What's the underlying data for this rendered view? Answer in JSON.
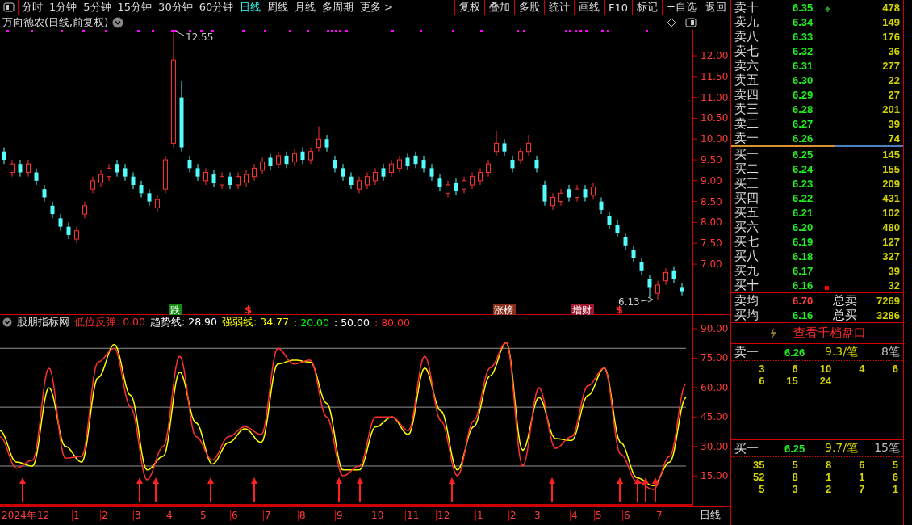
{
  "toolbar": {
    "periods": [
      {
        "label": "分时",
        "selected": false
      },
      {
        "label": "1分钟",
        "selected": false
      },
      {
        "label": "5分钟",
        "selected": false
      },
      {
        "label": "15分钟",
        "selected": false
      },
      {
        "label": "30分钟",
        "selected": false
      },
      {
        "label": "60分钟",
        "selected": false
      },
      {
        "label": "日线",
        "selected": true
      },
      {
        "label": "周线",
        "selected": false
      },
      {
        "label": "月线",
        "selected": false
      },
      {
        "label": "多周期",
        "selected": false
      },
      {
        "label": "更多 >",
        "selected": false
      }
    ],
    "buttons": [
      "复权",
      "叠加",
      "多股",
      "统计",
      "画线",
      "F10",
      "标记",
      "+自选",
      "返回"
    ]
  },
  "chart": {
    "title": "万向德农(日线,前复权)",
    "high_label": "12.55",
    "low_label": "6.13",
    "chart_data": {
      "type": "candlestick",
      "ylim": [
        5.8,
        12.62
      ],
      "yticks": [
        {
          "value": 12,
          "label": "12.00"
        },
        {
          "value": 11.5,
          "label": "11.50"
        },
        {
          "value": 11,
          "label": "11.00"
        },
        {
          "value": 10.5,
          "label": "10.50"
        },
        {
          "value": 10,
          "label": "10.00"
        },
        {
          "value": 9.5,
          "label": "9.50"
        },
        {
          "value": 9,
          "label": "9.00"
        },
        {
          "value": 8.5,
          "label": "8.50"
        },
        {
          "value": 8,
          "label": "8.00"
        },
        {
          "value": 7.5,
          "label": "7.50"
        },
        {
          "value": 7,
          "label": "7.00"
        }
      ],
      "ohlc": [
        [
          9.7,
          9.8,
          9.4,
          9.5
        ],
        [
          9.2,
          9.5,
          9.1,
          9.4
        ],
        [
          9.4,
          9.5,
          9.1,
          9.2
        ],
        [
          9.2,
          9.5,
          9.1,
          9.4
        ],
        [
          9.2,
          9.3,
          8.9,
          9.0
        ],
        [
          8.8,
          8.9,
          8.5,
          8.6
        ],
        [
          8.4,
          8.5,
          8.1,
          8.2
        ],
        [
          8.1,
          8.2,
          7.8,
          7.9
        ],
        [
          7.9,
          8.0,
          7.6,
          7.7
        ],
        [
          7.6,
          7.9,
          7.5,
          7.8
        ],
        [
          8.2,
          8.5,
          8.1,
          8.4
        ],
        [
          8.8,
          9.1,
          8.7,
          9.0
        ],
        [
          8.95,
          9.25,
          8.85,
          9.15
        ],
        [
          9.1,
          9.4,
          9.0,
          9.3
        ],
        [
          9.4,
          9.5,
          9.1,
          9.2
        ],
        [
          9.3,
          9.4,
          9.0,
          9.1
        ],
        [
          9.1,
          9.2,
          8.8,
          8.9
        ],
        [
          8.9,
          9.0,
          8.6,
          8.7
        ],
        [
          8.7,
          8.8,
          8.4,
          8.5
        ],
        [
          8.35,
          8.65,
          8.25,
          8.55
        ],
        [
          8.8,
          9.6,
          8.7,
          9.5
        ],
        [
          9.9,
          12.55,
          9.8,
          11.9
        ],
        [
          11.0,
          11.4,
          9.7,
          9.8
        ],
        [
          9.5,
          9.6,
          9.2,
          9.3
        ],
        [
          9.3,
          9.4,
          9.0,
          9.1
        ],
        [
          9.0,
          9.3,
          8.9,
          9.2
        ],
        [
          9.15,
          9.25,
          8.85,
          8.95
        ],
        [
          8.9,
          9.2,
          8.8,
          9.1
        ],
        [
          9.1,
          9.2,
          8.8,
          8.9
        ],
        [
          8.9,
          9.2,
          8.8,
          9.1
        ],
        [
          8.95,
          9.25,
          8.85,
          9.15
        ],
        [
          9.1,
          9.4,
          9.0,
          9.3
        ],
        [
          9.25,
          9.55,
          9.15,
          9.45
        ],
        [
          9.55,
          9.65,
          9.25,
          9.35
        ],
        [
          9.4,
          9.7,
          9.3,
          9.6
        ],
        [
          9.6,
          9.7,
          9.3,
          9.4
        ],
        [
          9.45,
          9.75,
          9.35,
          9.65
        ],
        [
          9.7,
          9.8,
          9.4,
          9.5
        ],
        [
          9.5,
          9.8,
          9.4,
          9.7
        ],
        [
          9.8,
          10.3,
          9.7,
          10.0
        ],
        [
          10.0,
          10.1,
          9.7,
          9.8
        ],
        [
          9.5,
          9.6,
          9.2,
          9.3
        ],
        [
          9.3,
          9.4,
          9.0,
          9.1
        ],
        [
          9.1,
          9.2,
          8.8,
          8.9
        ],
        [
          8.8,
          9.1,
          8.7,
          9.0
        ],
        [
          8.9,
          9.2,
          8.8,
          9.1
        ],
        [
          9.0,
          9.3,
          8.9,
          9.2
        ],
        [
          9.3,
          9.4,
          9.0,
          9.1
        ],
        [
          9.2,
          9.5,
          9.1,
          9.4
        ],
        [
          9.3,
          9.6,
          9.2,
          9.5
        ],
        [
          9.55,
          9.65,
          9.25,
          9.35
        ],
        [
          9.6,
          9.7,
          9.3,
          9.4
        ],
        [
          9.5,
          9.6,
          9.2,
          9.3
        ],
        [
          9.3,
          9.4,
          9.0,
          9.1
        ],
        [
          9.05,
          9.15,
          8.75,
          8.85
        ],
        [
          8.7,
          9.0,
          8.6,
          8.9
        ],
        [
          8.95,
          9.05,
          8.65,
          8.75
        ],
        [
          8.8,
          9.1,
          8.7,
          9.0
        ],
        [
          8.9,
          9.2,
          8.8,
          9.1
        ],
        [
          9.0,
          9.3,
          8.9,
          9.2
        ],
        [
          9.2,
          9.5,
          9.1,
          9.4
        ],
        [
          9.7,
          10.2,
          9.6,
          9.9
        ],
        [
          9.9,
          10.0,
          9.6,
          9.7
        ],
        [
          9.5,
          9.6,
          9.2,
          9.3
        ],
        [
          9.5,
          9.8,
          9.4,
          9.7
        ],
        [
          9.7,
          10.1,
          9.6,
          9.9
        ],
        [
          9.5,
          9.6,
          9.2,
          9.3
        ],
        [
          8.9,
          9.0,
          8.4,
          8.5
        ],
        [
          8.4,
          8.7,
          8.3,
          8.6
        ],
        [
          8.5,
          8.8,
          8.4,
          8.7
        ],
        [
          8.8,
          8.9,
          8.5,
          8.6
        ],
        [
          8.6,
          8.9,
          8.5,
          8.8
        ],
        [
          8.8,
          8.9,
          8.5,
          8.6
        ],
        [
          8.65,
          8.95,
          8.55,
          8.85
        ],
        [
          8.5,
          8.6,
          8.2,
          8.3
        ],
        [
          8.15,
          8.25,
          7.85,
          7.95
        ],
        [
          7.95,
          8.05,
          7.65,
          7.75
        ],
        [
          7.65,
          7.75,
          7.35,
          7.45
        ],
        [
          7.35,
          7.45,
          7.05,
          7.15
        ],
        [
          7.05,
          7.15,
          6.75,
          6.85
        ],
        [
          6.65,
          6.75,
          6.2,
          6.45
        ],
        [
          6.3,
          6.6,
          6.13,
          6.5
        ],
        [
          6.6,
          6.9,
          6.5,
          6.8
        ],
        [
          6.85,
          6.95,
          6.55,
          6.65
        ],
        [
          6.45,
          6.55,
          6.25,
          6.35
        ]
      ]
    },
    "signals": [
      {
        "text": "跌",
        "kind": "tag",
        "color": "#128a12"
      },
      {
        "text": "$",
        "kind": "mark",
        "color": "#ff2a2a"
      },
      {
        "text": "涨榜",
        "kind": "tag",
        "color": "#8a2e1c"
      },
      {
        "text": "增财",
        "kind": "tag",
        "color": "#a01830"
      },
      {
        "text": "$",
        "kind": "mark",
        "color": "#ff2a2a"
      }
    ]
  },
  "indicator": {
    "name": "股朋指标网",
    "legend": [
      {
        "text": "低位反弹: 0.00",
        "color": "#ff2a2a"
      },
      {
        "text": "趋势线: 28.90",
        "color": "#ffffff"
      },
      {
        "text": "强弱线: 34.77",
        "color": "#ffff00"
      },
      {
        "text": ": 20.00",
        "color": "#00ff00"
      },
      {
        "text": ": 50.00",
        "color": "#ffffff"
      },
      {
        "text": ": 80.00",
        "color": "#ff2a2a"
      }
    ],
    "chart_data": {
      "type": "line",
      "ylim": [
        -0.6,
        97
      ],
      "yticks": [
        {
          "value": 90,
          "label": "90.00"
        },
        {
          "value": 75,
          "label": "75.00"
        },
        {
          "value": 60,
          "label": "60.00"
        },
        {
          "value": 45,
          "label": "45.00"
        },
        {
          "value": 30,
          "label": "30.00"
        },
        {
          "value": 15,
          "label": "15.00"
        }
      ],
      "series": [
        {
          "color": "#ffff00",
          "values": [
            38,
            22,
            20,
            60,
            30,
            22,
            65,
            82,
            56,
            18,
            25,
            68,
            42,
            21,
            32,
            39,
            32,
            72,
            74,
            73,
            52,
            18,
            18,
            40,
            45,
            36,
            70,
            48,
            18,
            40,
            66,
            83,
            28,
            55,
            34,
            33,
            56,
            70,
            32,
            14,
            10,
            22,
            55
          ]
        },
        {
          "color": "#ff3030",
          "values": [
            35,
            19,
            23,
            70,
            24,
            25,
            73,
            80,
            50,
            13,
            30,
            76,
            35,
            23,
            35,
            40,
            36,
            80,
            72,
            74,
            45,
            15,
            20,
            45,
            45,
            38,
            76,
            43,
            15,
            43,
            70,
            83,
            20,
            60,
            29,
            35,
            61,
            70,
            26,
            12,
            8,
            25,
            62
          ]
        }
      ]
    }
  },
  "date_axis": {
    "labels": [
      "2024年",
      "12",
      "1",
      "2",
      "3",
      "4",
      "5",
      "6",
      "7",
      "8",
      "9",
      "10",
      "11",
      "12",
      "1",
      "2",
      "3",
      "4",
      "5",
      "6",
      "7"
    ],
    "period": "日线"
  },
  "quote": {
    "asks": [
      {
        "label": "卖十",
        "price": "6.35",
        "volume": "478",
        "marked": true
      },
      {
        "label": "卖九",
        "price": "6.34",
        "volume": "149",
        "marked": false
      },
      {
        "label": "卖八",
        "price": "6.33",
        "volume": "176",
        "marked": false
      },
      {
        "label": "卖七",
        "price": "6.32",
        "volume": "36",
        "marked": false
      },
      {
        "label": "卖六",
        "price": "6.31",
        "volume": "277",
        "marked": false
      },
      {
        "label": "卖五",
        "price": "6.30",
        "volume": "22",
        "marked": false
      },
      {
        "label": "卖四",
        "price": "6.29",
        "volume": "27",
        "marked": false
      },
      {
        "label": "卖三",
        "price": "6.28",
        "volume": "201",
        "marked": false
      },
      {
        "label": "卖二",
        "price": "6.27",
        "volume": "39",
        "marked": false
      },
      {
        "label": "卖一",
        "price": "6.26",
        "volume": "74",
        "marked": false
      }
    ],
    "bids": [
      {
        "label": "买一",
        "price": "6.25",
        "volume": "145",
        "marked": false
      },
      {
        "label": "买二",
        "price": "6.24",
        "volume": "155",
        "marked": false
      },
      {
        "label": "买三",
        "price": "6.23",
        "volume": "209",
        "marked": false
      },
      {
        "label": "买四",
        "price": "6.22",
        "volume": "431",
        "marked": false
      },
      {
        "label": "买五",
        "price": "6.21",
        "volume": "102",
        "marked": false
      },
      {
        "label": "买六",
        "price": "6.20",
        "volume": "480",
        "marked": false
      },
      {
        "label": "买七",
        "price": "6.19",
        "volume": "127",
        "marked": false
      },
      {
        "label": "买八",
        "price": "6.18",
        "volume": "327",
        "marked": false
      },
      {
        "label": "买九",
        "price": "6.17",
        "volume": "39",
        "marked": false
      },
      {
        "label": "买十",
        "price": "6.16",
        "volume": "32",
        "marked": true
      }
    ],
    "summary": [
      {
        "label": "卖均",
        "price": "6.70",
        "rising": true,
        "total_label": "总卖",
        "total": "7269"
      },
      {
        "label": "买均",
        "price": "6.16",
        "rising": false,
        "total_label": "总买",
        "total": "3286"
      }
    ],
    "depth_button": "查看千档盘口",
    "queues": [
      {
        "label": "卖一",
        "price": "6.26",
        "avg": "9.3/笔",
        "count": "8笔",
        "orders": [
          "3",
          "6",
          "10",
          "4",
          "6",
          "6",
          "15",
          "24"
        ]
      },
      {
        "label": "买一",
        "price": "6.25",
        "avg": "9.7/笔",
        "count": "15笔",
        "orders": [
          "35",
          "5",
          "8",
          "6",
          "5",
          "52",
          "8",
          "1",
          "1",
          "6",
          "5",
          "3",
          "2",
          "7",
          "1"
        ]
      }
    ]
  }
}
